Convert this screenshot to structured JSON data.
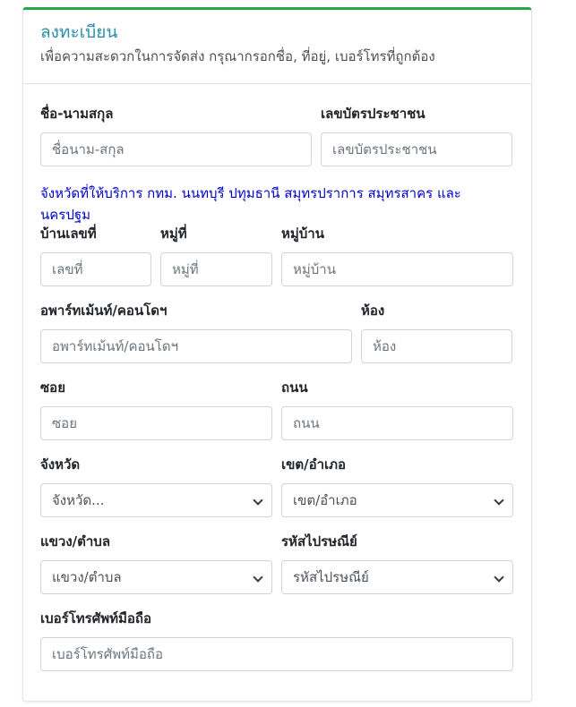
{
  "header": {
    "title": "ลงทะเบียน",
    "subtitle": "เพื่อความสะดวกในการจัดส่ง กรุณากรอกชื่อ, ที่อยู่, เบอร์โทรที่ถูกต้อง"
  },
  "form": {
    "name": {
      "label": "ชื่อ-นามสกุล",
      "placeholder": "ชื่อนาม-สกุล"
    },
    "id_card": {
      "label": "เลขบัตรประชาชน",
      "placeholder": "เลขบัตรประชาชน"
    },
    "notice": "จังหวัดที่ให้บริการ กทม. นนทบุรี ปทุมธานี สมุทรปราการ สมุทรสาคร และ นครปฐม",
    "house_no": {
      "label": "บ้านเลขที่",
      "placeholder": "เลขที่"
    },
    "moo": {
      "label": "หมู่ที่",
      "placeholder": "หมู่ที่"
    },
    "village": {
      "label": "หมู่บ้าน",
      "placeholder": "หมู่บ้าน"
    },
    "condo": {
      "label": "อพาร์ทเม้นท์/คอนโดฯ",
      "placeholder": "อพาร์ทเม้นท์/คอนโดฯ"
    },
    "room": {
      "label": "ห้อง",
      "placeholder": "ห้อง"
    },
    "soi": {
      "label": "ซอย",
      "placeholder": "ซอย"
    },
    "road": {
      "label": "ถนน",
      "placeholder": "ถนน"
    },
    "province": {
      "label": "จังหวัด",
      "value": "จังหวัด..."
    },
    "district": {
      "label": "เขต/อำเภอ",
      "value": "เขต/อำเภอ"
    },
    "subdistrict": {
      "label": "แขวง/ตำบล",
      "value": "แขวง/ตำบล"
    },
    "postcode": {
      "label": "รหัสไปรษณีย์",
      "value": "รหัสไปรษณีย์"
    },
    "phone": {
      "label": "เบอร์โทรศัพท์มือถือ",
      "placeholder": "เบอร์โทรศัพท์มือถือ"
    }
  }
}
